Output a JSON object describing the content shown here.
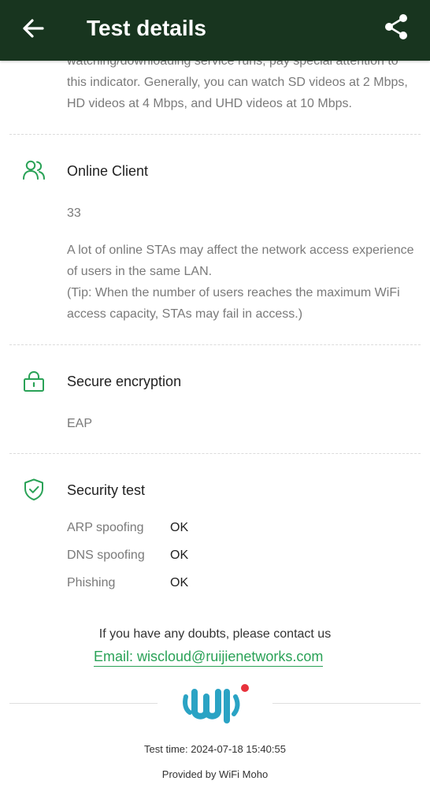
{
  "header": {
    "title": "Test details",
    "back_icon": "arrow-left-icon",
    "share_icon": "share-icon",
    "background_color": "#18351f"
  },
  "speed_section": {
    "description_partial": "watching/downloading service runs, pay special attention to this indicator. Generally, you can watch SD videos at 2 Mbps, HD videos at 4 Mbps, and UHD videos at 10 Mbps."
  },
  "online_client": {
    "icon": "users-icon",
    "title": "Online Client",
    "value": "33",
    "description_line1": "A lot of online STAs may affect the network access experience of users in the same LAN.",
    "description_line2": "(Tip: When the number of users reaches the maximum WiFi access capacity, STAs may fail in access.)"
  },
  "secure_encryption": {
    "icon": "lock-icon",
    "title": "Secure encryption",
    "value": "EAP"
  },
  "security_test": {
    "icon": "shield-check-icon",
    "title": "Security test",
    "items": [
      {
        "label": "ARP spoofing",
        "result": "OK"
      },
      {
        "label": "DNS spoofing",
        "result": "OK"
      },
      {
        "label": "Phishing",
        "result": "OK"
      }
    ]
  },
  "contact": {
    "text": "If you have any doubts, please contact us",
    "email_text": "Email: wiscloud@ruijienetworks.com"
  },
  "footer": {
    "logo": "wifi-moho-logo",
    "test_time": "Test time: 2024-07-18 15:40:55",
    "provided_by": "Provided by WiFi Moho"
  },
  "colors": {
    "accent": "#2aa257",
    "logo_blue": "#2aa3c4",
    "logo_red": "#e8323c",
    "grey_text": "#7a7a7a"
  }
}
